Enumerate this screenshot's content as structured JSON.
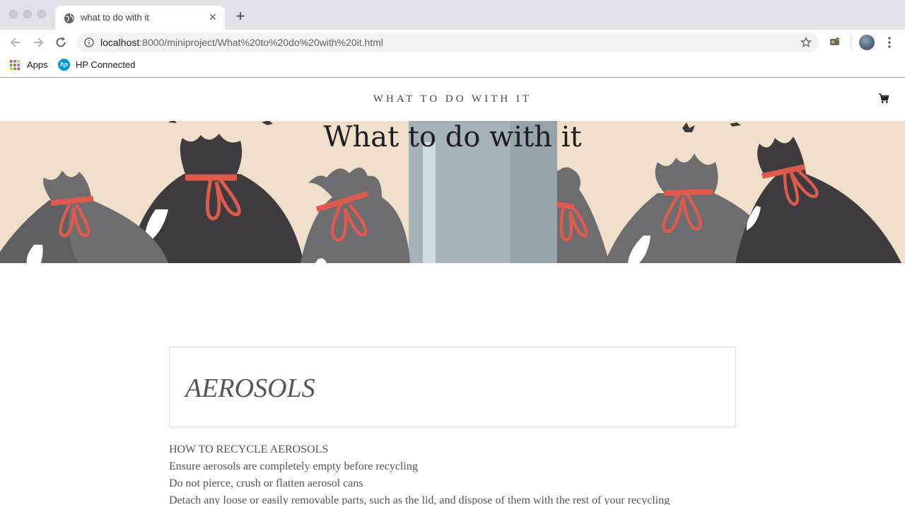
{
  "browser": {
    "tab_title": "what to do with it",
    "url_host": "localhost",
    "url_path": ":8000/miniproject/What%20to%20do%20with%20it.html",
    "bookmarks": [
      {
        "label": "Apps",
        "icon": "apps-grid-icon"
      },
      {
        "label": "HP Connected",
        "icon": "hp-logo-icon"
      }
    ]
  },
  "site": {
    "title": "WHAT TO DO WITH IT",
    "cart_icon": "cart-icon"
  },
  "hero": {
    "title": "What to do with it",
    "background_color": "#f0dfcb"
  },
  "section": {
    "heading": "AEROSOLS",
    "lines": [
      "HOW TO RECYCLE AEROSOLS",
      "Ensure aerosols are completely empty before recycling",
      "Do not pierce, crush or flatten aerosol cans",
      "Detach any loose or easily removable parts, such as the lid, and dispose of them with the rest of your recycling"
    ]
  }
}
